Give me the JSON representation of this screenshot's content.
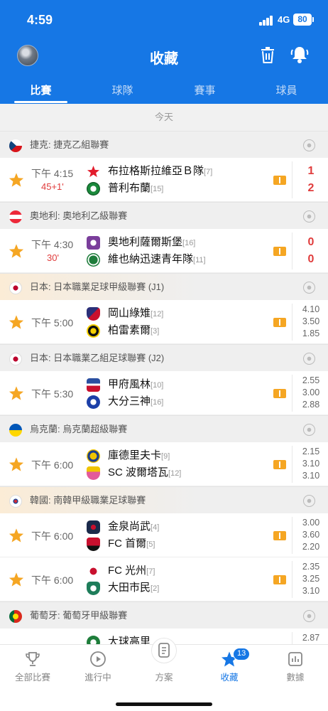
{
  "status_bar": {
    "time": "4:59",
    "network": "4G",
    "battery": "80"
  },
  "header": {
    "title": "收藏",
    "tabs": [
      {
        "label": "比賽"
      },
      {
        "label": "球隊"
      },
      {
        "label": "賽事"
      },
      {
        "label": "球員"
      }
    ]
  },
  "content": {
    "date_label": "今天",
    "leagues": [
      {
        "name": "捷克: 捷克乙組聯賽",
        "flag": "czech-flag"
      },
      {
        "name": "奧地利: 奧地利乙級聯賽",
        "flag": "austria-flag"
      },
      {
        "name": "日本: 日本職業足球甲級聯賽 (J1)",
        "flag": "japan-flag"
      },
      {
        "name": "日本: 日本職業乙組足球聯賽 (J2)",
        "flag": "japan-flag"
      },
      {
        "name": "烏克蘭: 烏克蘭超級聯賽",
        "flag": "ukraine-flag"
      },
      {
        "name": "韓國: 南韓甲級職業足球聯賽",
        "flag": "korea-flag"
      },
      {
        "name": "葡萄牙: 葡萄牙甲級聯賽",
        "flag": "portugal-flag"
      }
    ],
    "matches": [
      {
        "time": "下午 4:15",
        "minute": "45+1'",
        "home": "布拉格斯拉維亞Ｂ隊",
        "home_rank": "[7]",
        "away": "普利布蘭",
        "away_rank": "[15]",
        "score_home": "1",
        "score_away": "2"
      },
      {
        "time": "下午 4:30",
        "minute": "30'",
        "home": "奧地利薩爾斯堡",
        "home_rank": "[16]",
        "away": "維也納迅速青年隊",
        "away_rank": "[11]",
        "score_home": "0",
        "score_away": "0"
      },
      {
        "time": "下午 5:00",
        "home": "岡山綠雉",
        "home_rank": "[12]",
        "away": "柏雷素爾",
        "away_rank": "[3]",
        "odds": [
          "4.10",
          "3.50",
          "1.85"
        ]
      },
      {
        "time": "下午 5:30",
        "home": "甲府風林",
        "home_rank": "[10]",
        "away": "大分三神",
        "away_rank": "[16]",
        "odds": [
          "2.55",
          "3.00",
          "2.88"
        ]
      },
      {
        "time": "下午 6:00",
        "home": "庫德里夫卡",
        "home_rank": "[9]",
        "away": "SC 波爾塔瓦",
        "away_rank": "[12]",
        "odds": [
          "2.15",
          "3.10",
          "3.10"
        ]
      },
      {
        "time": "下午 6:00",
        "home": "金泉尚武",
        "home_rank": "[4]",
        "away": "FC 首爾",
        "away_rank": "[5]",
        "odds": [
          "3.00",
          "3.60",
          "2.20"
        ]
      },
      {
        "time": "下午 6:00",
        "home": "FC 光州",
        "home_rank": "[7]",
        "away": "大田市民",
        "away_rank": "[2]",
        "odds": [
          "2.35",
          "3.25",
          "3.10"
        ]
      }
    ],
    "partial_row": {
      "home": "大球高里",
      "odds_top": "2.87"
    }
  },
  "bottom_nav": {
    "items": [
      {
        "label": "全部比賽"
      },
      {
        "label": "進行中"
      },
      {
        "label": "方案"
      },
      {
        "label": "收藏"
      },
      {
        "label": "數據"
      }
    ],
    "favorites_badge": "13"
  },
  "colors": {
    "accent": "#1677e5",
    "live_score": "#e03c3c",
    "star": "#f5a623"
  }
}
